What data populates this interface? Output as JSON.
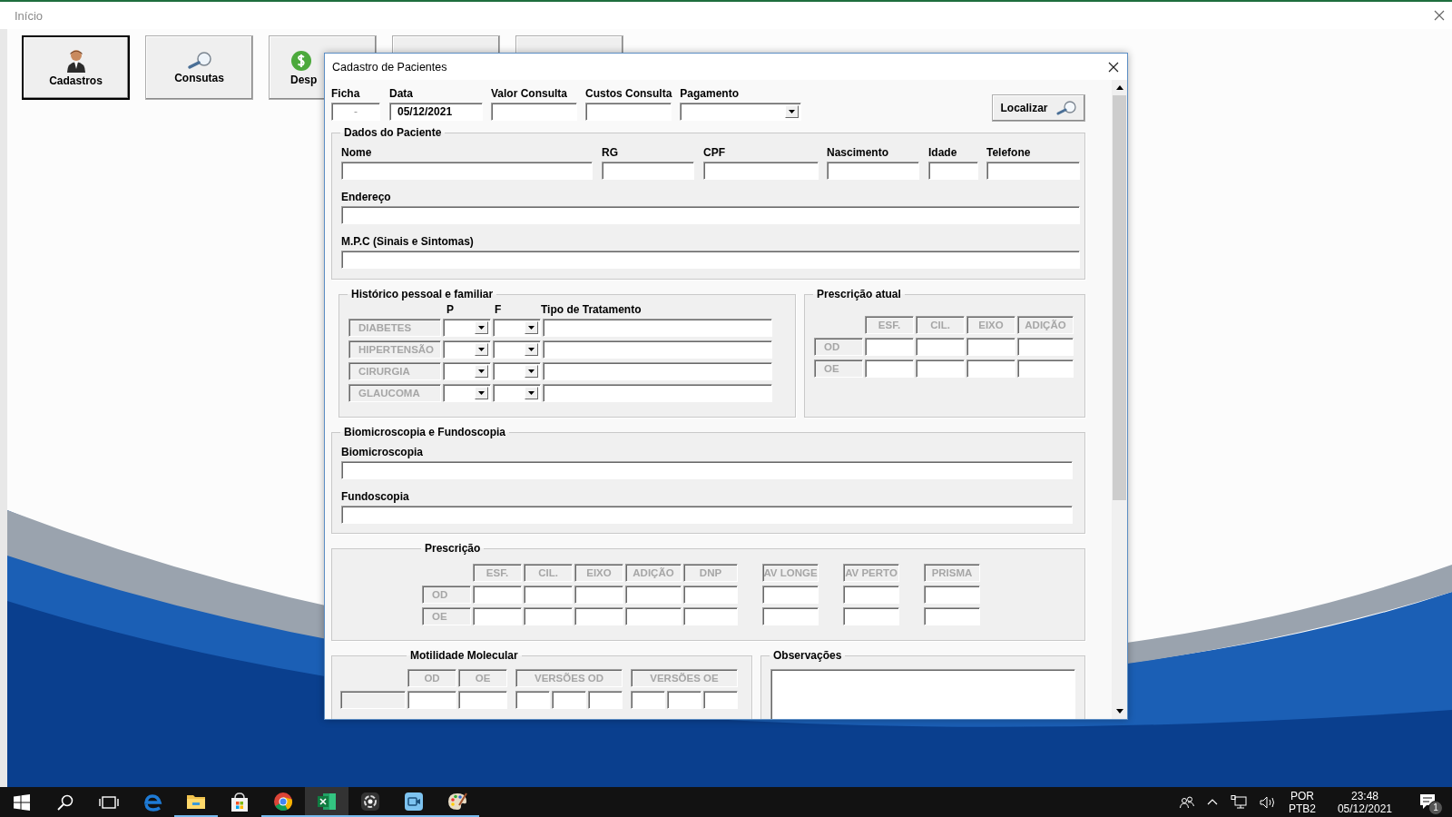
{
  "app": {
    "title": "Início",
    "buttons": [
      {
        "label": "Cadastros",
        "focused": true
      },
      {
        "label": "Consutas",
        "focused": false
      },
      {
        "label": "Desp",
        "focused": false
      },
      {
        "focused": false
      },
      {
        "focused": false
      }
    ]
  },
  "dialog": {
    "title": "Cadastro de Pacientes",
    "header_fields": [
      {
        "label": "Ficha",
        "value": "-",
        "kind": "text"
      },
      {
        "label": "Data",
        "value": "05/12/2021",
        "kind": "text"
      },
      {
        "label": "Valor Consulta",
        "kind": "text"
      },
      {
        "label": "Custos Consulta",
        "kind": "text"
      },
      {
        "label": "Pagamento",
        "kind": "dropdown"
      }
    ],
    "find_button": "Localizar",
    "patient": {
      "title": "Dados do Paciente",
      "rows": [
        [
          {
            "label": "Nome"
          },
          {
            "label": "RG"
          },
          {
            "label": "CPF"
          },
          {
            "label": "Nascimento"
          },
          {
            "label": "Idade"
          },
          {
            "label": "Telefone"
          }
        ],
        [
          {
            "label": "Endereço"
          }
        ],
        [
          {
            "label": "M.P.C (Sinais e Sintomas)"
          }
        ]
      ]
    },
    "history": {
      "title": "Histórico pessoal e familiar",
      "columns": [
        "P",
        "F",
        "Tipo de Tratamento"
      ],
      "rows": [
        "DIABETES",
        "HIPERTENSÃO",
        "CIRURGIA",
        "GLAUCOMA"
      ]
    },
    "current_prescription": {
      "title": "Prescrição atual",
      "columns": [
        "ESF.",
        "CIL.",
        "EIXO",
        "ADIÇÃO"
      ],
      "rows": [
        "OD",
        "OE"
      ]
    },
    "exams": {
      "title": "Biomicroscopia e Fundoscopia",
      "fields": [
        "Biomicroscopia",
        "Fundoscopia"
      ]
    },
    "prescription": {
      "title": "Prescrição",
      "columns": [
        "ESF.",
        "CIL.",
        "EIXO",
        "ADIÇÃO",
        "DNP"
      ],
      "extra_columns": [
        "AV LONGE",
        "AV PERTO",
        "PRISMA"
      ],
      "rows": [
        "OD",
        "OE"
      ]
    },
    "motility": {
      "title": "Motilidade Molecular",
      "columns": [
        "OD",
        "OE",
        "VERSÕES OD",
        "VERSÕES OE"
      ]
    },
    "observations": {
      "title": "Observações"
    }
  },
  "taskbar": {
    "apps": [
      {
        "running": false,
        "active": false
      },
      {
        "running": true,
        "active": false
      },
      {
        "running": false,
        "active": false
      },
      {
        "running": true,
        "active": false
      },
      {
        "running": true,
        "active": true
      },
      {
        "running": true,
        "active": false
      },
      {
        "running": true,
        "active": false
      },
      {
        "running": true,
        "active": false
      }
    ],
    "language": "POR",
    "layout": "PTB2",
    "time": "23:48",
    "date": "05/12/2021",
    "notifications": "1"
  }
}
